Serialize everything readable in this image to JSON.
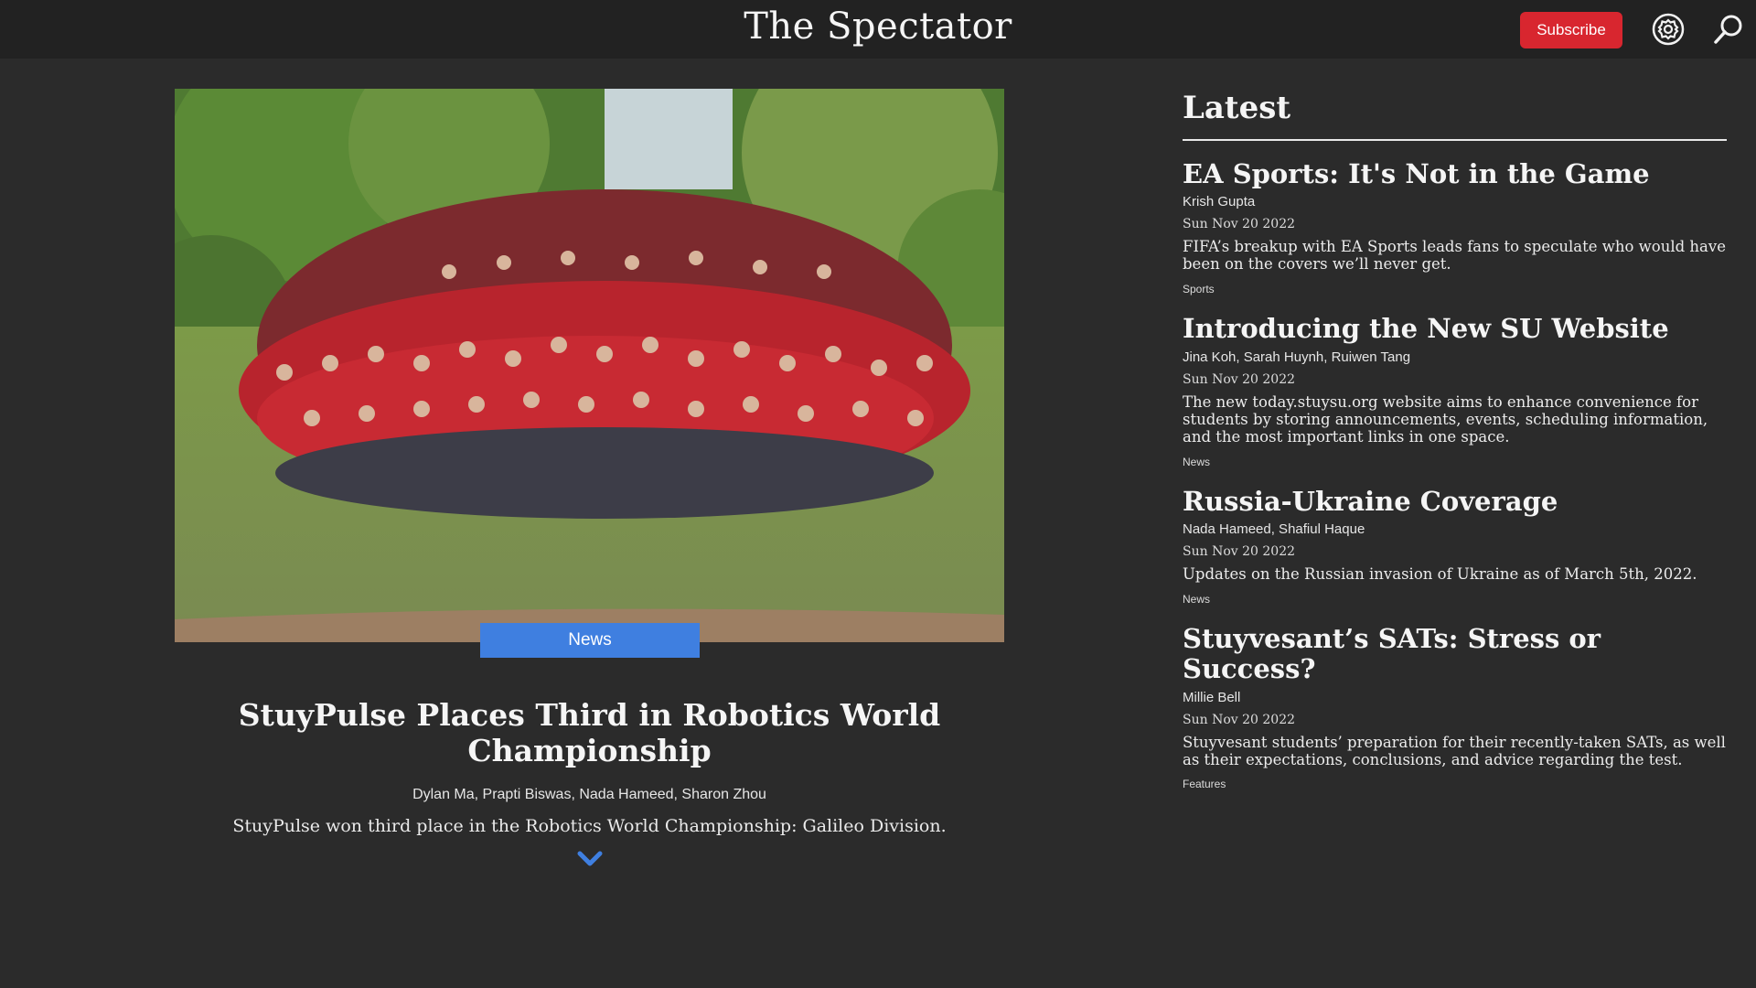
{
  "header": {
    "site_title": "The Spectator",
    "subscribe_label": "Subscribe",
    "settings_icon": "gear-icon",
    "search_icon": "search-icon",
    "accent": "#d8262f"
  },
  "feature": {
    "section": "News",
    "title": "StuyPulse Places Third in Robotics World Championship",
    "authors": "Dylan Ma, Prapti Biswas, Nada Hameed, Sharon Zhou",
    "summary": "StuyPulse won third place in the Robotics World Championship: Galileo Division.",
    "section_color": "#3f7fe0",
    "more_icon": "chevron-down-icon"
  },
  "latest": {
    "heading": "Latest",
    "articles": [
      {
        "title": "EA Sports: It's Not in the Game",
        "authors": "Krish Gupta",
        "date": "Sun Nov 20 2022",
        "summary": "FIFA’s breakup with EA Sports leads fans to speculate who would have been on the covers we’ll never get.",
        "section": "Sports"
      },
      {
        "title": "Introducing the New SU Website",
        "authors": "Jina Koh, Sarah Huynh, Ruiwen Tang",
        "date": "Sun Nov 20 2022",
        "summary": "The new today.stuysu.org website aims to enhance convenience for students by storing announcements, events, scheduling information, and the most important links in one space.",
        "section": "News"
      },
      {
        "title": "Russia-Ukraine Coverage",
        "authors": "Nada Hameed, Shafiul Haque",
        "date": "Sun Nov 20 2022",
        "summary": "Updates on the Russian invasion of Ukraine as of March 5th, 2022.",
        "section": "News"
      },
      {
        "title": "Stuyvesant’s SATs: Stress or Success?",
        "authors": "Millie Bell",
        "date": "Sun Nov 20 2022",
        "summary": "Stuyvesant students’ preparation for their recently-taken SATs, as well as their expectations, conclusions, and advice regarding the test.",
        "section": "Features"
      }
    ]
  }
}
